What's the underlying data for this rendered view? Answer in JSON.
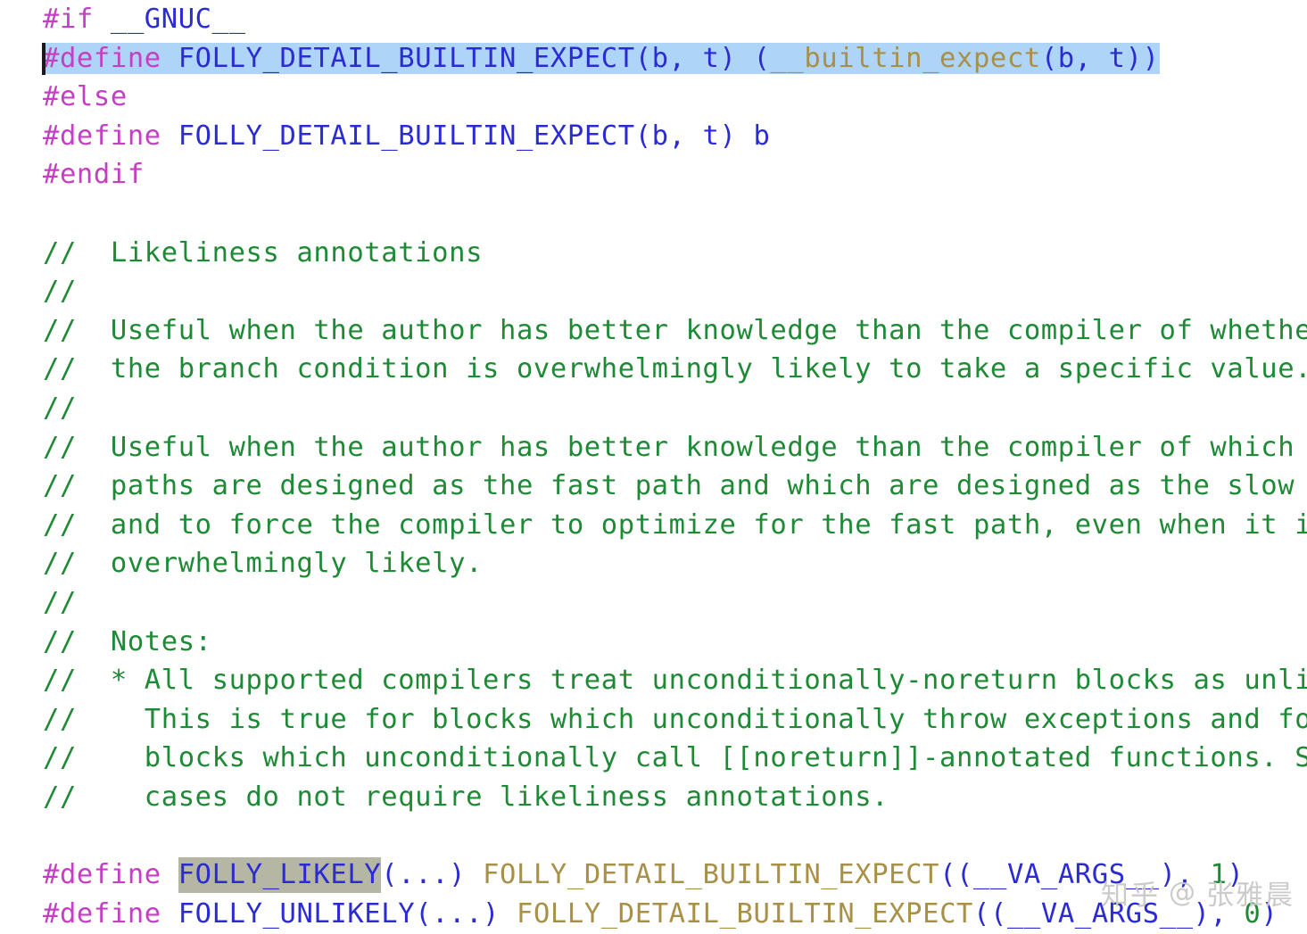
{
  "editor": {
    "background_color": "#ffffff",
    "selection_color": "#aed5f7",
    "occurrence_highlight_color": "#b6b6a4",
    "caret_color": "#1b1b1b",
    "colors": {
      "preprocessor": "#c43fc4",
      "macro_identifier": "#2b2bd4",
      "function_name": "#a89048",
      "comment": "#1f8a35",
      "number": "#1f8a35"
    }
  },
  "lines": {
    "l1": {
      "kw": "#if",
      "sp": " ",
      "id": "__GNUC__"
    },
    "l2": {
      "kw": "#define",
      "sp": " ",
      "name": "FOLLY_DETAIL_BUILTIN_EXPECT(b, t)",
      "sp2": " ",
      "open": "(",
      "fn": "__builtin_expect",
      "args": "(b, t)",
      "close": ")"
    },
    "l3": {
      "kw": "#else"
    },
    "l4": {
      "kw": "#define",
      "sp": " ",
      "name": "FOLLY_DETAIL_BUILTIN_EXPECT(b, t) b"
    },
    "l5": {
      "kw": "#endif"
    },
    "c1": "//  Likeliness annotations",
    "c2": "//",
    "c3": "//  Useful when the author has better knowledge than the compiler of whether",
    "c4": "//  the branch condition is overwhelmingly likely to take a specific value.",
    "c5": "//",
    "c6": "//  Useful when the author has better knowledge than the compiler of which code",
    "c7": "//  paths are designed as the fast path and which are designed as the slow path,",
    "c8": "//  and to force the compiler to optimize for the fast path, even when it is not",
    "c9": "//  overwhelmingly likely.",
    "c10": "//",
    "c11": "//  Notes:",
    "c12": "//  * All supported compilers treat unconditionally-noreturn blocks as unlikely.",
    "c13": "//    This is true for blocks which unconditionally throw exceptions and for",
    "c14": "//    blocks which unconditionally call [[noreturn]]-annotated functions. Such",
    "c15": "//    cases do not require likeliness annotations.",
    "l6": {
      "kw": "#define",
      "sp": " ",
      "name": "FOLLY_LIKELY",
      "params": "(...)",
      "sp2": " ",
      "fn": "FOLLY_DETAIL_BUILTIN_EXPECT",
      "open": "((",
      "va": "__VA_ARGS__",
      "mid": "), ",
      "num": "1",
      "close": ")"
    },
    "l7": {
      "kw": "#define",
      "sp": " ",
      "name": "FOLLY_UNLIKELY",
      "params": "(...)",
      "sp2": " ",
      "fn": "FOLLY_DETAIL_BUILTIN_EXPECT",
      "open": "((",
      "va": "__VA_ARGS__",
      "mid": "), ",
      "num": "0",
      "close": ")"
    }
  },
  "watermark": {
    "site": "知乎",
    "at": "@",
    "user": "张雅晨"
  }
}
